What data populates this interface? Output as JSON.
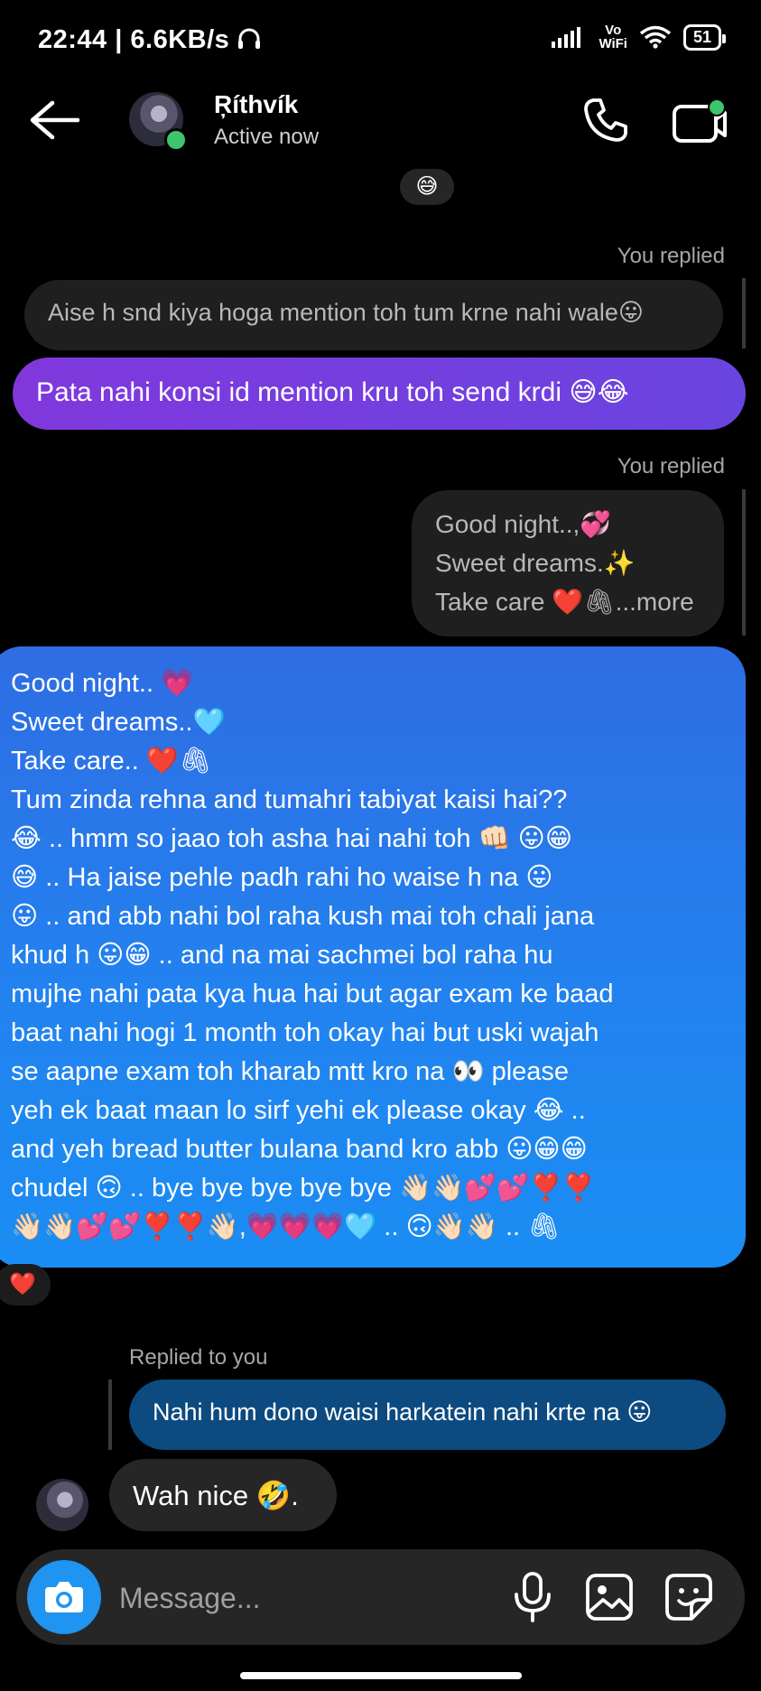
{
  "status_bar": {
    "time": "22:44",
    "speed": "6.6KB/s",
    "volte_top": "Vo",
    "volte_bottom": "WiFi",
    "battery": "51"
  },
  "header": {
    "name": "Ŗíthvík",
    "status": "Active now"
  },
  "messages": {
    "top_reaction": "😅",
    "reply1": {
      "tag": "You replied",
      "quote": "Aise h snd kiya hoga mention toh tum krne nahi wale😛",
      "text": "Pata nahi konsi id mention kru toh send krdi 😅😂"
    },
    "reply2": {
      "tag": "You replied",
      "quote_lines": [
        "Good night..,💞",
        "Sweet dreams.✨",
        "Take care ❤️🖇...more"
      ]
    },
    "long_message": {
      "lines": [
        "Good night.. 💗",
        "Sweet dreams..🩵",
        "Take care.. ❤️🖇",
        "Tum zinda rehna and tumahri tabiyat kaisi hai??",
        "😂 .. hmm so jaao toh asha hai nahi toh 👊🏻 😛😁",
        "😅 .. Ha jaise pehle padh rahi ho waise h na  😛",
        "😛 .. and abb nahi bol raha kush mai toh chali jana",
        "khud h 😛😁 .. and na mai sachmei bol raha hu",
        "mujhe nahi pata kya hua hai but agar exam ke baad",
        "baat nahi hogi 1 month toh okay hai but uski wajah",
        "se aapne exam toh kharab mtt kro na 👀 please",
        "yeh ek baat maan lo sirf yehi ek please okay 😂 ..",
        "and yeh bread butter bulana band kro abb 😛😁😁",
        "chudel 🙃 .. bye bye bye bye bye 👋🏻👋🏻💕💕❣️❣️",
        "👋🏻👋🏻💕💕❣️❣️👋🏻,💗💗💗🩵 .. 🙃👋🏻👋🏻 .. 🖇"
      ],
      "reaction": "❤️"
    },
    "reply3": {
      "tag": "Replied to you",
      "quote": "Nahi hum dono waisi harkatein nahi krte na 😛",
      "text": "Wah nice 🤣."
    }
  },
  "composer": {
    "placeholder": "Message..."
  },
  "colors": {
    "accent_blue": "#1f94f0",
    "purple_bubble": "#7a3fdf",
    "online": "#3ec46d"
  }
}
